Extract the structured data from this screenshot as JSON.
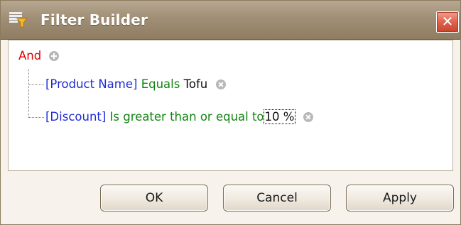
{
  "window": {
    "title": "Filter Builder",
    "close_glyph": "✕"
  },
  "filter": {
    "root_operator": "And",
    "conditions": [
      {
        "field": "[Product Name]",
        "operator": "Equals",
        "value": "Tofu"
      },
      {
        "field": "[Discount]",
        "operator": "Is greater than or equal to",
        "value": "10 %"
      }
    ]
  },
  "buttons": {
    "ok": "OK",
    "cancel": "Cancel",
    "apply": "Apply"
  },
  "colors": {
    "group_operator": "#e00000",
    "field": "#1e2bd6",
    "condition_operator": "#128412",
    "title_bar": "#9c8a70"
  }
}
